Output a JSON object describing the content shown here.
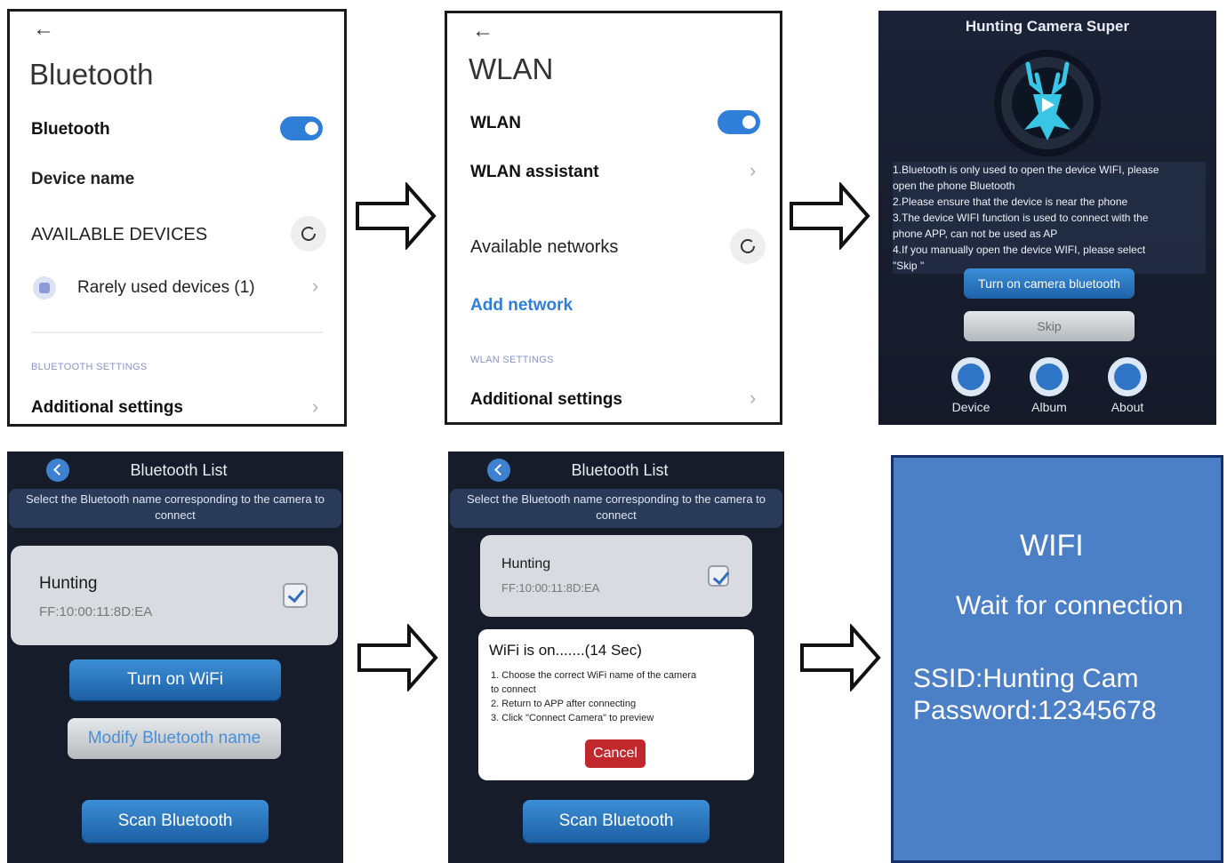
{
  "bluetooth_settings": {
    "title": "Bluetooth",
    "bluetooth_label": "Bluetooth",
    "bluetooth_on": true,
    "device_name_label": "Device name",
    "available_devices_label": "AVAILABLE DEVICES",
    "rarely_used_label": "Rarely used devices (1)",
    "section_header": "BLUETOOTH SETTINGS",
    "additional_settings_label": "Additional settings"
  },
  "wlan_settings": {
    "title": "WLAN",
    "wlan_label": "WLAN",
    "wlan_on": true,
    "assistant_label": "WLAN assistant",
    "available_networks_label": "Available networks",
    "add_network_label": "Add network",
    "section_header": "WLAN SETTINGS",
    "additional_settings_label": "Additional settings"
  },
  "hunting_main": {
    "title": "Hunting Camera Super",
    "info_lines": [
      "1.Bluetooth is only used to open the device WIFI, please",
      "open the phone Bluetooth",
      "2.Please ensure that the device is near the phone",
      "3.The device WIFI function is used to connect with the",
      "phone APP, can not be used as AP",
      "4.If you manually open the device WIFI, please select",
      "\"Skip \""
    ],
    "turn_on_bt_button": "Turn on camera bluetooth",
    "skip_button": "Skip",
    "nav": [
      "Device",
      "Album",
      "About"
    ]
  },
  "bt_list_1": {
    "title": "Bluetooth List",
    "instruction": "Select the Bluetooth name corresponding to the camera to connect",
    "device_name": "Hunting",
    "device_mac": "FF:10:00:11:8D:EA",
    "turn_on_wifi_button": "Turn on WiFi",
    "modify_name_button": "Modify Bluetooth name",
    "scan_button": "Scan Bluetooth"
  },
  "bt_list_2": {
    "title": "Bluetooth List",
    "instruction": "Select the Bluetooth name corresponding to the camera to connect",
    "device_name": "Hunting",
    "device_mac": "FF:10:00:11:8D:EA",
    "dialog_title": "WiFi is on.......(14 Sec)",
    "dialog_lines": [
      "1. Choose the correct WiFi name of the camera",
      "to connect",
      "2. Return to APP after connecting",
      "3. Click \"Connect Camera\" to preview"
    ],
    "cancel_button": "Cancel",
    "scan_button": "Scan Bluetooth"
  },
  "wifi_screen": {
    "title": "WIFI",
    "status": "Wait for connection",
    "ssid": "SSID:Hunting Cam",
    "password": "Password:12345678"
  },
  "colors": {
    "accent_blue": "#2f7fd8",
    "dark_bg": "#161c2a",
    "wifi_bg": "#4b7fc6",
    "cancel_red": "#c0282e"
  }
}
